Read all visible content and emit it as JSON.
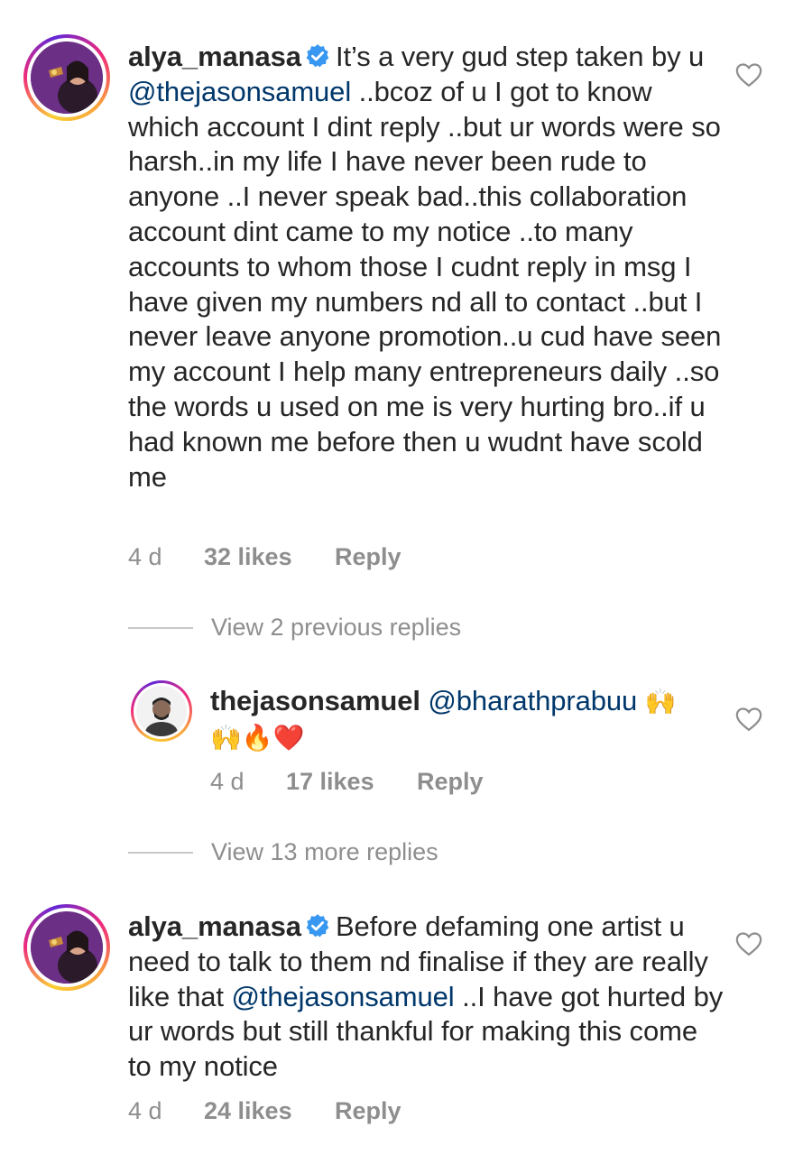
{
  "comments": [
    {
      "username": "alya_manasa",
      "text_parts": {
        "p1": "It’s a very gud step taken by u ",
        "mention": "@thejasonsamuel",
        "p2": " ..bcoz of u I got to know which account I dint reply ..but ur words were so harsh..in my life I have never been rude to anyone ..I never speak bad..this collaboration account dint came to my notice ..to many accounts to whom those I cudnt reply in msg I have given my numbers nd all to contact ..but I never leave anyone promotion..u cud have seen my account I help many entrepreneurs daily ..so the words u used on me is very hurting bro..if u had known me before then u wudnt have scold me"
      },
      "time": "4 d",
      "likes": "32 likes",
      "reply_label": "Reply"
    },
    {
      "username": "alya_manasa",
      "text_parts": {
        "p1": "Before defaming one artist u need to talk to them nd finalise if they are really like that ",
        "mention": "@thejasonsamuel",
        "p2": " ..I have got hurted by ur words but still thankful for making this come to my notice"
      },
      "time": "4 d",
      "likes": "24 likes",
      "reply_label": "Reply"
    }
  ],
  "view_previous": "View 2 previous replies",
  "reply": {
    "username": "thejasonsamuel",
    "mention": "@bharathprabuu",
    "emojis_line1": "🙌",
    "emojis_line2": "🙌🔥❤️",
    "time": "4 d",
    "likes": "17 likes",
    "reply_label": "Reply"
  },
  "view_more": "View 13 more replies",
  "icons": {
    "verified": "verified-badge-icon",
    "like": "heart-icon"
  },
  "colors": {
    "verified": "#3897f0",
    "mention": "#00376b",
    "meta": "#8e8e8e"
  }
}
